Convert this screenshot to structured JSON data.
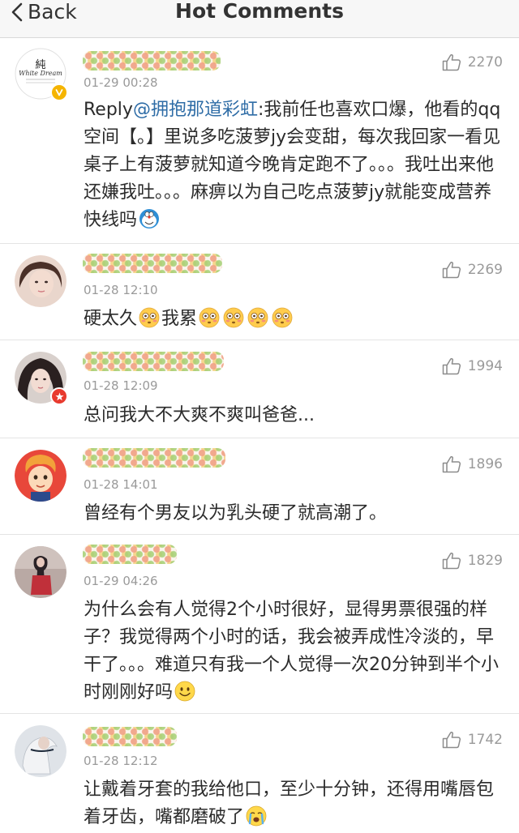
{
  "nav": {
    "back_label": "Back",
    "title": "Hot Comments"
  },
  "comments": [
    {
      "avatar_text_top": "純",
      "avatar_text_script": "White Dream",
      "badge": "yellow-v",
      "time": "01-29 00:28",
      "likes": "2270",
      "reply_prefix": "Reply",
      "mention": "@拥抱那道彩虹",
      "text": ":我前任也喜欢口爆，他看的qq空间【。】里说多吃菠萝jy会变甜，每次我回家一看见桌子上有菠萝就知道今晚肯定跑不了。。。我吐出来他还嫌我吐。。。麻痹以为自己吃点菠萝jy就能变成营养快线吗",
      "emoji_end": "doraemon"
    },
    {
      "time": "01-28 12:10",
      "likes": "2269",
      "text_a": "硬太久",
      "text_b": "我累"
    },
    {
      "badge": "red-star",
      "time": "01-28 12:09",
      "likes": "1994",
      "text": "总问我大不大爽不爽叫爸爸..."
    },
    {
      "time": "01-28 14:01",
      "likes": "1896",
      "text": "曾经有个男友以为乳头硬了就高潮了。"
    },
    {
      "time": "01-29 04:26",
      "likes": "1829",
      "text": "为什么会有人觉得2个小时很好，显得男票很强的样子？我觉得两个小时的话，我会被弄成性冷淡的，早干了。。。难道只有我一个人觉得一次20分钟到半个小时刚刚好吗",
      "emoji_end": "smile"
    },
    {
      "time": "01-28 12:12",
      "likes": "1742",
      "text": "让戴着牙套的我给他口，至少十分钟，还得用嘴唇包着牙齿，嘴都磨破了",
      "emoji_end": "crying"
    }
  ],
  "colors": {
    "mention": "#2e6ca6",
    "meta_gray": "#9a9a9a",
    "badge_yellow": "#f5b400",
    "badge_red": "#e83a2e"
  }
}
